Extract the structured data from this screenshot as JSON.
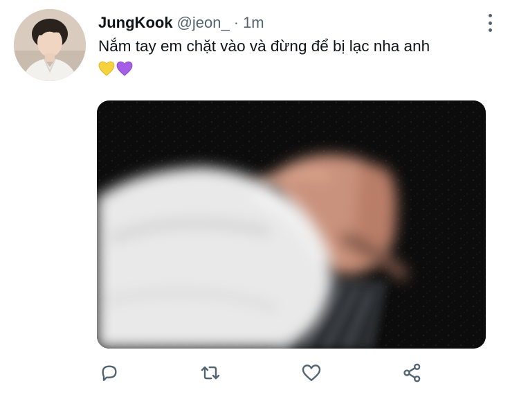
{
  "tweet": {
    "author_name": "JungKook",
    "handle": "@jeon_",
    "separator": "·",
    "timestamp": "1m",
    "text": "Nắm tay em chặt vào và đừng để bị lạc nha anh",
    "emojis": [
      "yellow-heart",
      "purple-heart"
    ]
  },
  "actions": [
    "reply-icon",
    "retweet-icon",
    "like-icon",
    "share-icon"
  ],
  "colors": {
    "text": "#0f1419",
    "secondary": "#536471",
    "icon": "#536471",
    "yellow_heart": "#f6d33d",
    "purple_heart": "#a55fe6"
  }
}
